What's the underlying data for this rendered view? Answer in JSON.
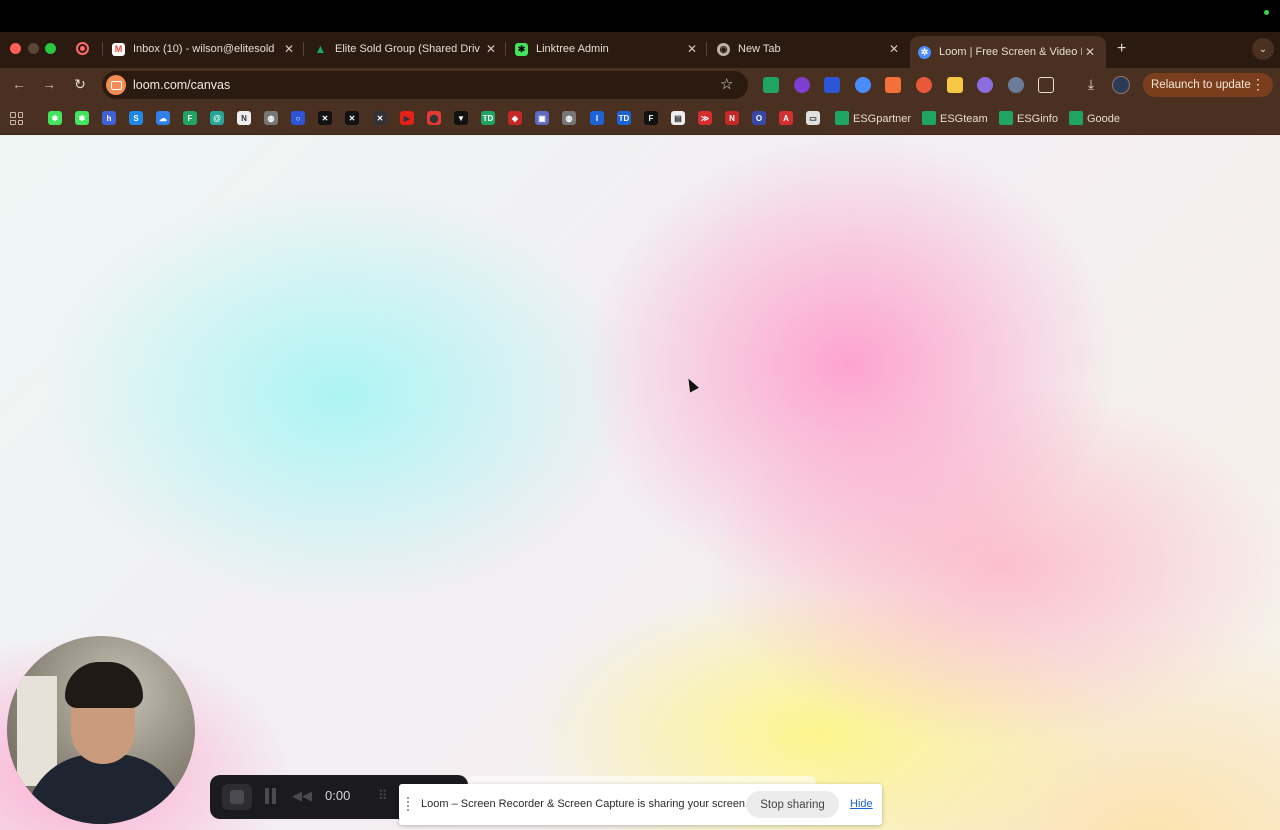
{
  "browser": {
    "tabs": [
      {
        "title": "Inbox (10) - wilson@elitesold",
        "icon": "gmail-icon",
        "color": "#ea4335"
      },
      {
        "title": "Elite Sold Group (Shared Driv",
        "icon": "google-drive-icon",
        "color": "#1fa463"
      },
      {
        "title": "Linktree Admin",
        "icon": "linktree-icon",
        "color": "#43e55e"
      },
      {
        "title": "New Tab",
        "icon": "chrome-icon",
        "color": "#bfb3aa"
      },
      {
        "title": "Loom | Free Screen & Video R",
        "icon": "loom-icon",
        "color": "#4a8cff",
        "active": true
      }
    ],
    "new_tab_label": "+",
    "tab_search_label": "⌄",
    "url": "loom.com/canvas",
    "relaunch_label": "Relaunch to update",
    "relaunch_more": "⋮"
  },
  "bookmarks": {
    "icons": [
      {
        "name": "linktree-bookmark-icon",
        "color": "#43e55e",
        "glyph": "✱"
      },
      {
        "name": "linktree-bookmark-icon-2",
        "color": "#43e55e",
        "glyph": "✱"
      },
      {
        "name": "hubspot-bookmark-icon",
        "color": "#4062d8",
        "glyph": "h"
      },
      {
        "name": "s-bookmark-icon",
        "color": "#1e88e5",
        "glyph": "S"
      },
      {
        "name": "onedrive-bookmark-icon",
        "color": "#2f80ed",
        "glyph": "☁"
      },
      {
        "name": "f-bookmark-icon",
        "color": "#1fa463",
        "glyph": "F"
      },
      {
        "name": "at-bookmark-icon",
        "color": "#26a69a",
        "glyph": "@"
      },
      {
        "name": "notion-bookmark-icon",
        "color": "#eeeeee",
        "glyph": "N"
      },
      {
        "name": "globe-bookmark-icon",
        "color": "#777777",
        "glyph": "◍"
      },
      {
        "name": "ring-bookmark-icon",
        "color": "#2d55d8",
        "glyph": "○"
      },
      {
        "name": "x-bookmark-icon",
        "color": "#111111",
        "glyph": "✕"
      },
      {
        "name": "x-bookmark-icon-2",
        "color": "#111111",
        "glyph": "✕"
      },
      {
        "name": "x-bookmark-icon-3",
        "color": "#333333",
        "glyph": "✕"
      },
      {
        "name": "youtube-bookmark-icon",
        "color": "#e62117",
        "glyph": "▶"
      },
      {
        "name": "maps-bookmark-icon",
        "color": "#e53935",
        "glyph": "⬤"
      },
      {
        "name": "vector-bookmark-icon",
        "color": "#111111",
        "glyph": "▼"
      },
      {
        "name": "td-bookmark-icon",
        "color": "#1fa463",
        "glyph": "TD"
      },
      {
        "name": "red-bookmark-icon",
        "color": "#c62828",
        "glyph": "◆"
      },
      {
        "name": "calendar-bookmark-icon",
        "color": "#5c6bc0",
        "glyph": "▣"
      },
      {
        "name": "globe-bookmark-icon-2",
        "color": "#777777",
        "glyph": "◍"
      },
      {
        "name": "i-bookmark-icon",
        "color": "#1e63d6",
        "glyph": "I"
      },
      {
        "name": "td-blue-bookmark-icon",
        "color": "#1e63d6",
        "glyph": "TD"
      },
      {
        "name": "f-black-bookmark-icon",
        "color": "#111111",
        "glyph": "F"
      },
      {
        "name": "doc-bookmark-icon",
        "color": "#eeeeee",
        "glyph": "▤"
      },
      {
        "name": "red-swoosh-bookmark-icon",
        "color": "#d32f2f",
        "glyph": "≫"
      },
      {
        "name": "n-red-bookmark-icon",
        "color": "#c62828",
        "glyph": "N"
      },
      {
        "name": "o-bookmark-icon",
        "color": "#3949ab",
        "glyph": "O"
      },
      {
        "name": "acrobat-bookmark-icon",
        "color": "#d32f2f",
        "glyph": "A"
      },
      {
        "name": "flag-bookmark-icon",
        "color": "#e0e0e0",
        "glyph": "▭"
      }
    ],
    "folders": [
      {
        "label": "ESGpartner"
      },
      {
        "label": "ESGteam"
      },
      {
        "label": "ESGinfo"
      },
      {
        "label": "Goode"
      }
    ]
  },
  "recorder": {
    "time": "0:00",
    "rewind_glyph": "◀◀",
    "grid_glyph": "⠿"
  },
  "sharing_bar": {
    "message": "Loom – Screen Recorder & Screen Capture is sharing your screen.",
    "stop_label": "Stop sharing",
    "hide_label": "Hide"
  },
  "colors": {
    "tabstrip": "#2b1a0f",
    "toolbar": "#4a3020",
    "relaunch": "#7a3e1c",
    "link": "#1a63d6"
  }
}
